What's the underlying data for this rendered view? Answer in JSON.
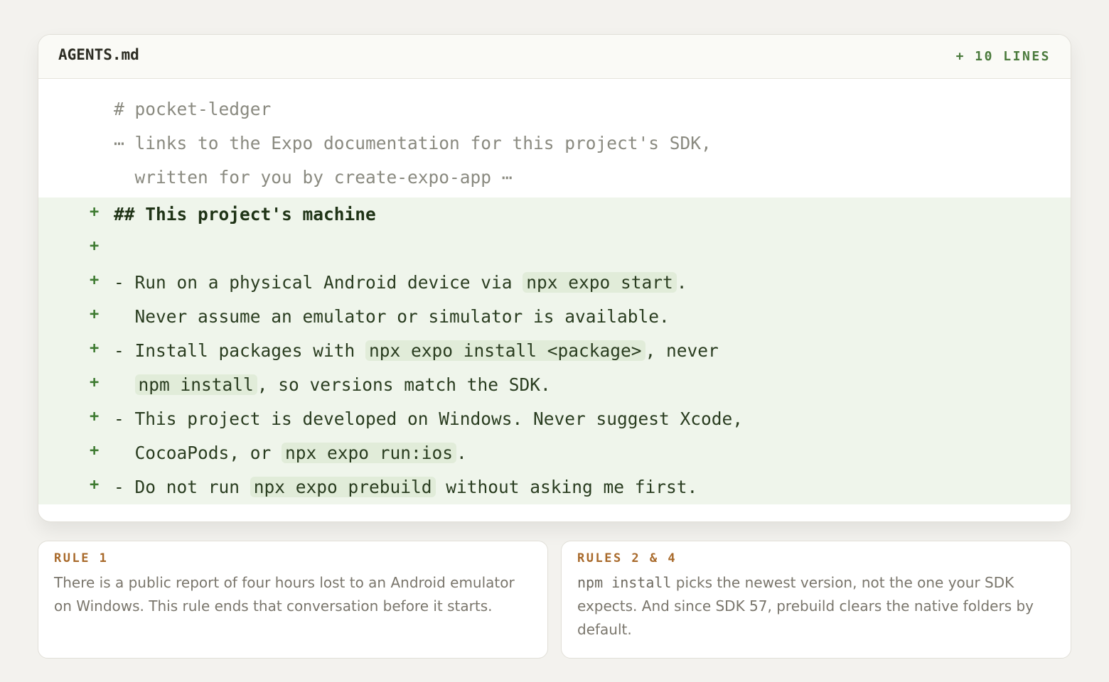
{
  "file": {
    "name": "AGENTS.md",
    "added_badge": "+ 10 LINES"
  },
  "context_lines": [
    "# pocket-ledger",
    "⋯ links to the Expo documentation for this project's SDK,",
    "  written for you by create-expo-app ⋯"
  ],
  "added_marker": "+",
  "added_lines": [
    {
      "parts": [
        "## This project's machine"
      ]
    },
    {
      "parts": [
        ""
      ]
    },
    {
      "parts": [
        "- Run on a physical Android device via ",
        "npx expo start",
        "."
      ]
    },
    {
      "parts": [
        "  Never assume an emulator or simulator is available."
      ]
    },
    {
      "parts": [
        "- Install packages with ",
        "npx expo install <package>",
        ", never"
      ]
    },
    {
      "parts": [
        "  ",
        "npm install",
        ", so versions match the SDK."
      ]
    },
    {
      "parts": [
        "- This project is developed on Windows. Never suggest Xcode,"
      ]
    },
    {
      "parts": [
        "  CocoaPods, or ",
        "npx expo run:ios",
        "."
      ]
    },
    {
      "parts": [
        "- Do not run ",
        "npx expo prebuild",
        " without asking me first."
      ]
    }
  ],
  "notes": [
    {
      "label": "RULE 1",
      "body": "There is a public report of four hours lost to an Android emulator on Windows. This rule ends that conversation before it starts."
    },
    {
      "label": "RULES 2 & 4",
      "body_code": "npm install",
      "body": " picks the newest version, not the one your SDK expects. And since SDK 57, prebuild clears the native folders by default."
    }
  ]
}
